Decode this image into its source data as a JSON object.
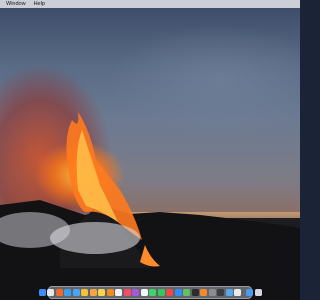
{
  "menubar": {
    "items": [
      "Window",
      "Help"
    ]
  },
  "dock": {
    "apps": [
      {
        "name": "finder-icon",
        "color": "#3b8df0"
      },
      {
        "name": "launchpad-icon",
        "color": "#e7e7ee"
      },
      {
        "name": "firefox-icon",
        "color": "#f06a2a"
      },
      {
        "name": "safari-icon",
        "color": "#3aa0ee"
      },
      {
        "name": "mail-icon",
        "color": "#4aa3f5"
      },
      {
        "name": "chrome-icon",
        "color": "#f3c334"
      },
      {
        "name": "photos-icon",
        "color": "#f4a640"
      },
      {
        "name": "notes-icon",
        "color": "#f6d64c"
      },
      {
        "name": "vlc-icon",
        "color": "#f28a1e"
      },
      {
        "name": "reminders-icon",
        "color": "#f2f2f2"
      },
      {
        "name": "music-icon",
        "color": "#fa4a68"
      },
      {
        "name": "podcasts-icon",
        "color": "#a15bd8"
      },
      {
        "name": "calendar-icon",
        "color": "#f7f7f7"
      },
      {
        "name": "messages-icon",
        "color": "#3fd36a"
      },
      {
        "name": "facetime-icon",
        "color": "#35c759"
      },
      {
        "name": "news-icon",
        "color": "#f04848"
      },
      {
        "name": "appstore-icon",
        "color": "#2f8df5"
      },
      {
        "name": "maps-icon",
        "color": "#61c25f"
      },
      {
        "name": "terminal-icon",
        "color": "#2b2b2b"
      },
      {
        "name": "books-icon",
        "color": "#f58a2b"
      },
      {
        "name": "settings-icon",
        "color": "#8c8c93"
      },
      {
        "name": "activity-icon",
        "color": "#3c3c3c"
      },
      {
        "name": "preview-icon",
        "color": "#59a6e8"
      },
      {
        "name": "textedit-icon",
        "color": "#ececec"
      }
    ],
    "trailing": [
      {
        "name": "downloads-folder-icon",
        "color": "#4c9af0"
      },
      {
        "name": "trash-icon",
        "color": "#d6d8dd"
      }
    ]
  }
}
